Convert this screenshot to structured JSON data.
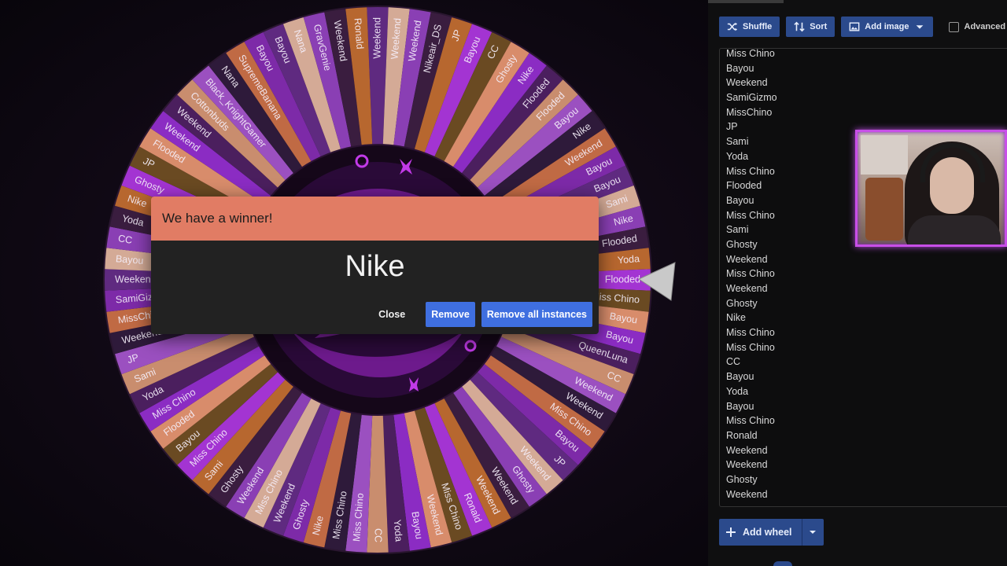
{
  "wheel": {
    "labels": [
      "Weekend",
      "Weekend",
      "Weekend",
      "Nikeair_DS",
      "JP",
      "Bayou",
      "CC",
      "Ghosty",
      "Nike",
      "Flooded",
      "Flooded",
      "Bayou",
      "Nike",
      "Weekend",
      "Bayou",
      "Bayou",
      "Sami",
      "Nike",
      "Flooded",
      "Yoda",
      "Flooded",
      "Miss Chino",
      "Bayou",
      "Bayou",
      "QueenLuna",
      "CC",
      "Weekend",
      "Weekend",
      "Miss Chino",
      "Bayou",
      "JP",
      "Weekend",
      "Ghosty",
      "Weekend",
      "Weekend",
      "Ronald",
      "Miss Chino",
      "Weekend",
      "Bayou",
      "Yoda",
      "CC",
      "Miss Chino",
      "Miss Chino",
      "Nike",
      "Ghosty",
      "Weekend",
      "Miss Chino",
      "Weekend",
      "Ghosty",
      "Sami",
      "Miss Chino",
      "Bayou",
      "Flooded",
      "Miss Chino",
      "Yoda",
      "Sami",
      "JP",
      "Weekend",
      "MissChino",
      "SamiGizmo",
      "Weekend",
      "Bayou",
      "CC",
      "Yoda",
      "Nike",
      "Ghosty",
      "JP",
      "Flooded",
      "Weekend",
      "Weekend",
      "Cottonbuds",
      "Black_KnightGamer",
      "Nana",
      "SupremeBanana",
      "Bayou",
      "Bayou",
      "Nana",
      "GravGenie",
      "Weekend",
      "Ronald"
    ],
    "colors": [
      "#5f2a80",
      "#d4aa96",
      "#8a3fb4",
      "#3a1d3f",
      "#b7672f",
      "#a334d2",
      "#6a4a22",
      "#d88c6b",
      "#8b2cc3",
      "#4b1f5e",
      "#c98d6e",
      "#9b50c0",
      "#2e1a3a",
      "#c06a44",
      "#7d2aa8"
    ],
    "center_colors": [
      "#2a0a38",
      "#6d1a8c",
      "#13061b"
    ]
  },
  "dialog": {
    "header": "We have a winner!",
    "winner": "Nike",
    "close_label": "Close",
    "remove_label": "Remove",
    "remove_all_label": "Remove all instances"
  },
  "toolbar": {
    "shuffle_label": "Shuffle",
    "sort_label": "Sort",
    "add_image_label": "Add image",
    "advanced_label": "Advanced"
  },
  "entries": [
    "Miss Chino",
    "Bayou",
    "Weekend",
    "SamiGizmo",
    "MissChino",
    "JP",
    "Sami",
    "Yoda",
    "Miss Chino",
    "Flooded",
    "Bayou",
    "Miss Chino",
    "Sami",
    "Ghosty",
    "Weekend",
    "Miss Chino",
    "Weekend",
    "Ghosty",
    "Nike",
    "Miss Chino",
    "Miss Chino",
    "CC",
    "Bayou",
    "Yoda",
    "Bayou",
    "Miss Chino",
    "Ronald",
    "Weekend",
    "Weekend",
    "Ghosty",
    "Weekend"
  ],
  "add_wheel_label": "Add wheel",
  "accent": "#2b4a8c",
  "dialog_accent": "#e17c64"
}
